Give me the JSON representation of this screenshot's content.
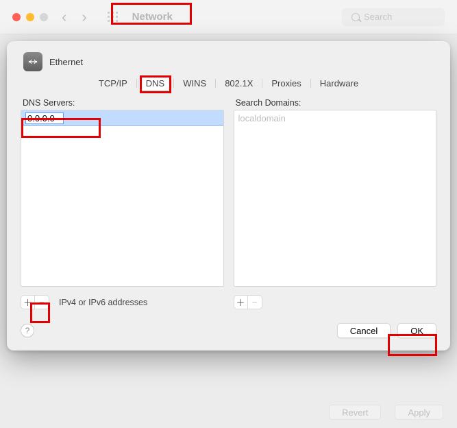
{
  "toolbar": {
    "title": "Network",
    "searchPlaceholder": "Search"
  },
  "sheet": {
    "interface": "Ethernet",
    "tabs": [
      "TCP/IP",
      "DNS",
      "WINS",
      "802.1X",
      "Proxies",
      "Hardware"
    ],
    "activeTab": "DNS",
    "dns": {
      "label": "DNS Servers:",
      "editingValue": "0.0.0.0",
      "hint": "IPv4 or IPv6 addresses"
    },
    "search": {
      "label": "Search Domains:",
      "items": [
        "localdomain"
      ]
    },
    "buttons": {
      "cancel": "Cancel",
      "ok": "OK"
    }
  },
  "bottom": {
    "revert": "Revert",
    "apply": "Apply"
  }
}
